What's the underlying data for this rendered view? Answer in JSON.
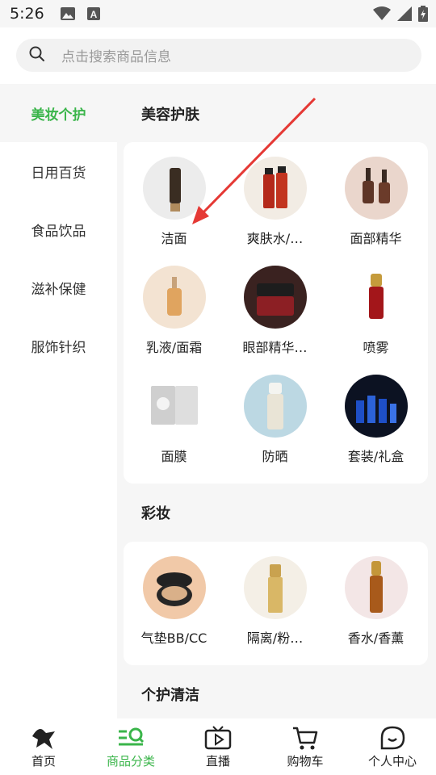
{
  "status_bar": {
    "time": "5:26"
  },
  "search": {
    "placeholder": "点击搜索商品信息"
  },
  "sidebar": {
    "items": [
      {
        "label": "美妆个护",
        "active": true
      },
      {
        "label": "日用百货"
      },
      {
        "label": "食品饮品"
      },
      {
        "label": "滋补保健"
      },
      {
        "label": "服饰针织"
      }
    ]
  },
  "sections": [
    {
      "title": "美容护肤",
      "items": [
        {
          "label": "洁面",
          "icon": "cleanser-tube-icon"
        },
        {
          "label": "爽肤水/…",
          "icon": "toner-bottles-icon"
        },
        {
          "label": "面部精华",
          "icon": "serum-bottles-icon"
        },
        {
          "label": "乳液/面霜",
          "icon": "lotion-bottle-icon"
        },
        {
          "label": "眼部精华…",
          "icon": "cream-jar-icon"
        },
        {
          "label": "喷雾",
          "icon": "spray-bottle-icon"
        },
        {
          "label": "面膜",
          "icon": "sheet-mask-icon"
        },
        {
          "label": "防晒",
          "icon": "sunscreen-bottle-icon"
        },
        {
          "label": "套装/礼盒",
          "icon": "gift-set-icon"
        }
      ]
    },
    {
      "title": "彩妆",
      "items": [
        {
          "label": "气垫BB/CC",
          "icon": "cushion-compact-icon"
        },
        {
          "label": "隔离/粉…",
          "icon": "primer-bottle-icon"
        },
        {
          "label": "香水/香薰",
          "icon": "perfume-bottle-icon"
        }
      ]
    },
    {
      "title": "个护清洁"
    }
  ],
  "bottom_nav": {
    "items": [
      {
        "label": "首页"
      },
      {
        "label": "商品分类",
        "active": true
      },
      {
        "label": "直播"
      },
      {
        "label": "购物车"
      },
      {
        "label": "个人中心"
      }
    ]
  },
  "colors": {
    "accent": "#3ab54a",
    "annotation_arrow": "#e53935"
  }
}
